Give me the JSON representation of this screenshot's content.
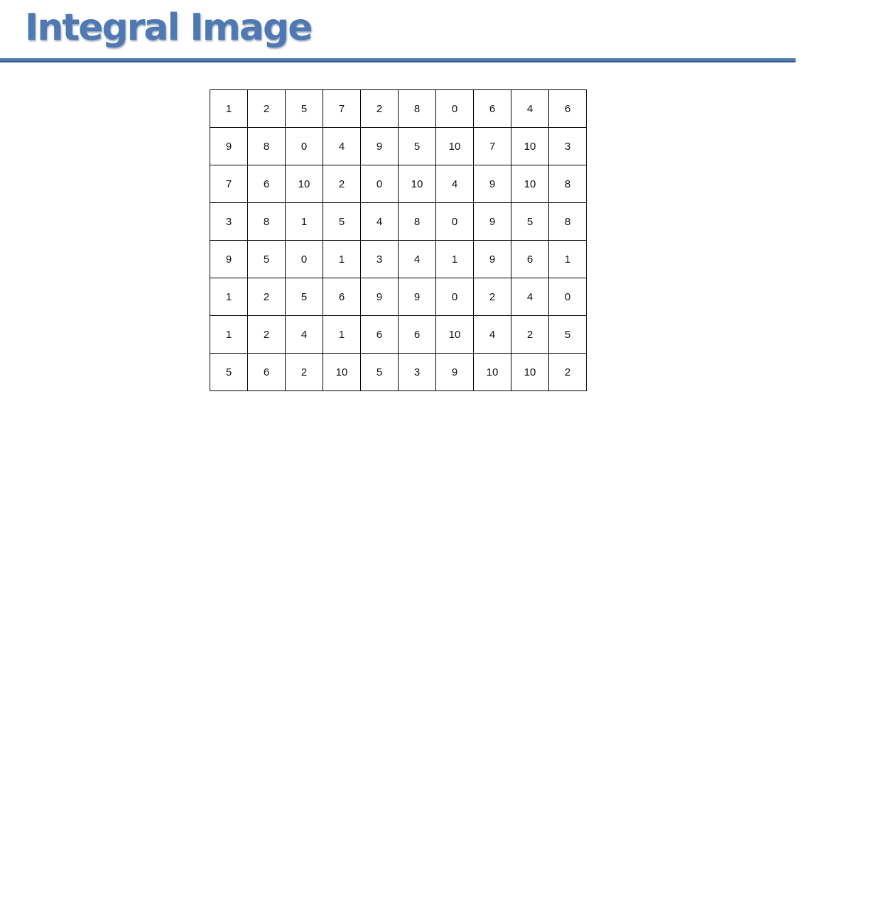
{
  "header": {
    "title": "Integral Image"
  },
  "colors": {
    "title": "#4f79b3",
    "rule": "#4f79b3",
    "grid_border": "#000000"
  },
  "matrix": {
    "rows": [
      [
        "1",
        "2",
        "5",
        "7",
        "2",
        "8",
        "0",
        "6",
        "4",
        "6"
      ],
      [
        "9",
        "8",
        "0",
        "4",
        "9",
        "5",
        "10",
        "7",
        "10",
        "3"
      ],
      [
        "7",
        "6",
        "10",
        "2",
        "0",
        "10",
        "4",
        "9",
        "10",
        "8"
      ],
      [
        "3",
        "8",
        "1",
        "5",
        "4",
        "8",
        "0",
        "9",
        "5",
        "8"
      ],
      [
        "9",
        "5",
        "0",
        "1",
        "3",
        "4",
        "1",
        "9",
        "6",
        "1"
      ],
      [
        "1",
        "2",
        "5",
        "6",
        "9",
        "9",
        "0",
        "2",
        "4",
        "0"
      ],
      [
        "1",
        "2",
        "4",
        "1",
        "6",
        "6",
        "10",
        "4",
        "2",
        "5"
      ],
      [
        "5",
        "6",
        "2",
        "10",
        "5",
        "3",
        "9",
        "10",
        "10",
        "2"
      ]
    ]
  }
}
